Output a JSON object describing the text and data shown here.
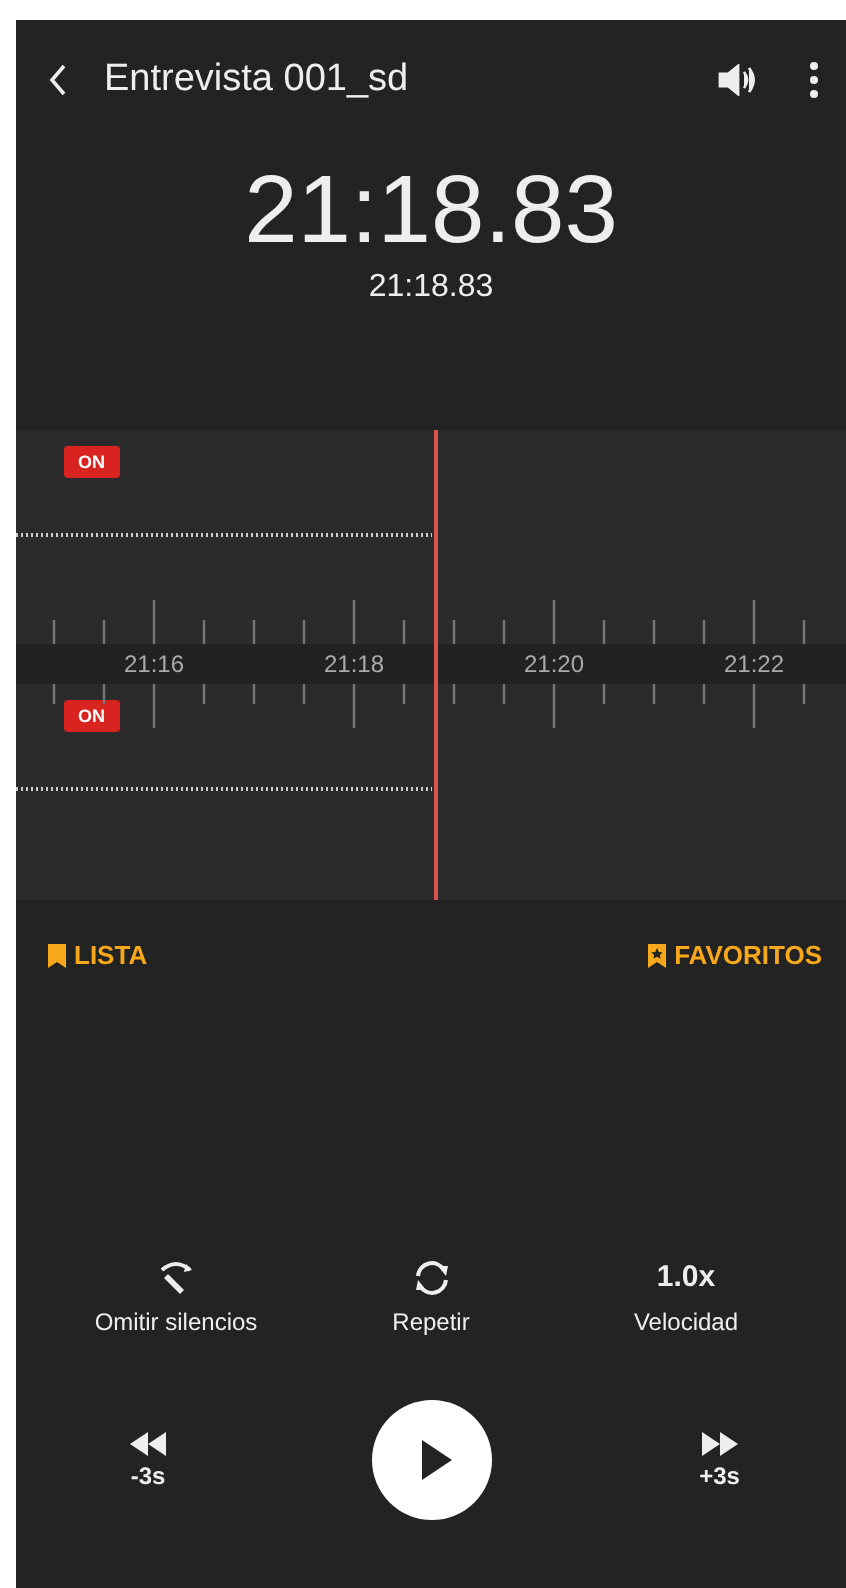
{
  "header": {
    "title": "Entrevista 001_sd"
  },
  "time": {
    "main": "21:18.83",
    "sub": "21:18.83"
  },
  "tracks": [
    {
      "badge": "ON"
    },
    {
      "badge": "ON"
    }
  ],
  "timeline": {
    "labels": [
      "21:16",
      "21:18",
      "21:20",
      "21:22"
    ]
  },
  "links": [
    {
      "kind": "list",
      "label": "LISTA"
    },
    {
      "kind": "favorites",
      "label": "FAVORITOS"
    }
  ],
  "controls": [
    {
      "kind": "skip-silence",
      "label": "Omitir silencios"
    },
    {
      "kind": "repeat",
      "label": "Repetir"
    },
    {
      "kind": "speed",
      "value": "1.0x",
      "label": "Velocidad"
    }
  ],
  "transport": {
    "rewind": "-3s",
    "forward": "+3s"
  }
}
